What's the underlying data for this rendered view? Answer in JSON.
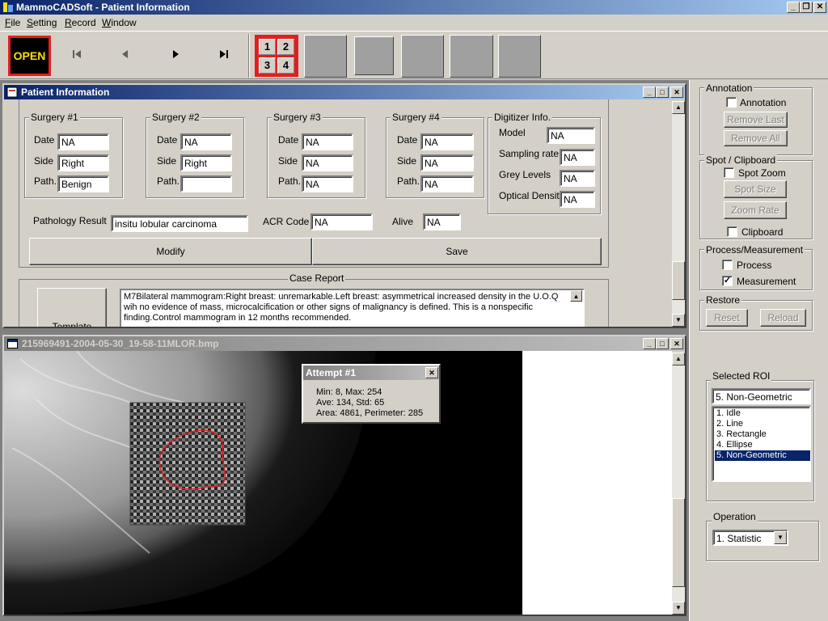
{
  "app": {
    "title": "MammoCADSoft - Patient Information"
  },
  "menu": [
    {
      "key": "F",
      "rest": "ile"
    },
    {
      "key": "S",
      "rest": "etting"
    },
    {
      "key": "R",
      "rest": "ecord"
    },
    {
      "key": "W",
      "rest": "indow"
    }
  ],
  "toolbar": {
    "open_label": "OPEN",
    "grid": [
      "1",
      "2",
      "3",
      "4"
    ]
  },
  "patient_window": {
    "title": "Patient Information",
    "surgeries": [
      {
        "title": "Surgery #1",
        "date": "NA",
        "side": "Right",
        "path": "Benign"
      },
      {
        "title": "Surgery #2",
        "date": "NA",
        "side": "Right",
        "path": ""
      },
      {
        "title": "Surgery #3",
        "date": "NA",
        "side": "NA",
        "path": "NA"
      },
      {
        "title": "Surgery #4",
        "date": "NA",
        "side": "NA",
        "path": "NA"
      }
    ],
    "labels": {
      "date": "Date",
      "side": "Side",
      "path": "Path."
    },
    "digitizer": {
      "title": "Digitizer Info.",
      "model_label": "Model",
      "model": "NA",
      "sampling_label": "Sampling rate",
      "sampling": "NA",
      "grey_label": "Grey Levels",
      "grey": "NA",
      "optical_label": "Optical Density",
      "optical": "NA"
    },
    "pathology_label": "Pathology Result",
    "pathology": "insitu lobular carcinoma",
    "acr_label": "ACR Code",
    "acr": "NA",
    "alive_label": "Alive",
    "alive": "NA",
    "modify_label": "Modify",
    "save_label": "Save",
    "case_report_label": "Case Report",
    "template_label": "Template",
    "case_report_text": "M7Bilateral mammogram:Right breast: unremarkable.Left breast: asymmetrical increased density in the U.O.Q wih no evidence of mass, microcalcification or other signs of malignancy is defined. This is a nonspecific finding.Control mammogram in 12 months recommended."
  },
  "image_window": {
    "title": "215969491-2004-05-30_19-58-11MLOR.bmp",
    "popup": {
      "title": "Attempt #1",
      "line1": "Min: 8, Max: 254",
      "line2": "Ave: 134, Std: 65",
      "line3": "Area: 4861, Perimeter: 285"
    }
  },
  "side_panel": {
    "annotation": {
      "title": "Annotation",
      "check_label": "Annotation",
      "checked": false,
      "remove_last": "Remove Last",
      "remove_all": "Remove All"
    },
    "spot": {
      "title": "Spot / Clipboard",
      "spot_zoom": "Spot Zoom",
      "spot_size": "Spot Size",
      "zoom_rate": "Zoom Rate",
      "clipboard": "Clipboard"
    },
    "process": {
      "title": "Process/Measurement",
      "process_label": "Process",
      "measurement_label": "Measurement",
      "measurement_checked": true
    },
    "restore": {
      "title": "Restore",
      "reset": "Reset",
      "reload": "Reload"
    },
    "roi": {
      "title": "Selected ROI",
      "value": "5. Non-Geometric",
      "items": [
        "1. Idle",
        "2. Line",
        "3. Rectangle",
        "4. Ellipse",
        "5. Non-Geometric"
      ],
      "selected_index": 4
    },
    "operation": {
      "title": "Operation",
      "value": "1. Statistic"
    }
  },
  "colors": {
    "accent": "#0a246a",
    "highlight": "#e02020",
    "open_text": "#ffe000",
    "roi_outline": "#e02020"
  }
}
